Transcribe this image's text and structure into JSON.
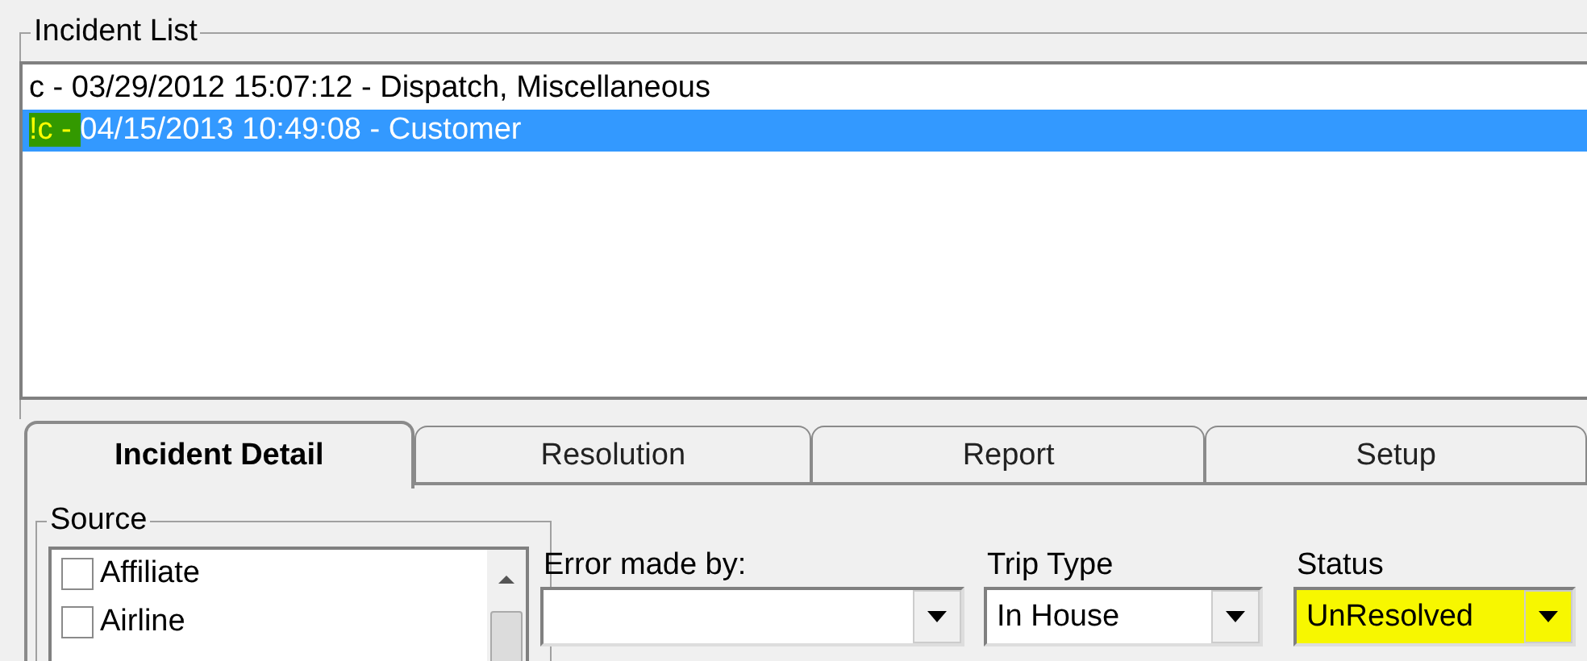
{
  "incident_list": {
    "title": "Incident List",
    "items": [
      {
        "prefix": "c -",
        "text": "03/29/2012 15:07:12 - Dispatch, Miscellaneous",
        "selected": false,
        "highlighted": false
      },
      {
        "prefix": "!c -",
        "text": "04/15/2013 10:49:08 - Customer",
        "selected": true,
        "highlighted": true
      }
    ]
  },
  "tabs": [
    {
      "label": "Incident Detail",
      "selected": true
    },
    {
      "label": "Resolution",
      "selected": false
    },
    {
      "label": "Report",
      "selected": false
    },
    {
      "label": "Setup",
      "selected": false
    }
  ],
  "source": {
    "title": "Source",
    "items": [
      {
        "label": "Affiliate",
        "checked": false
      },
      {
        "label": "Airline",
        "checked": false
      }
    ]
  },
  "fields": [
    {
      "label": "Error made by:",
      "highlighted": false
    },
    {
      "label": "Trip Type",
      "value": "In House",
      "highlighted": false
    },
    {
      "label": "Status",
      "value": "UnResolved",
      "highlighted": true
    }
  ]
}
